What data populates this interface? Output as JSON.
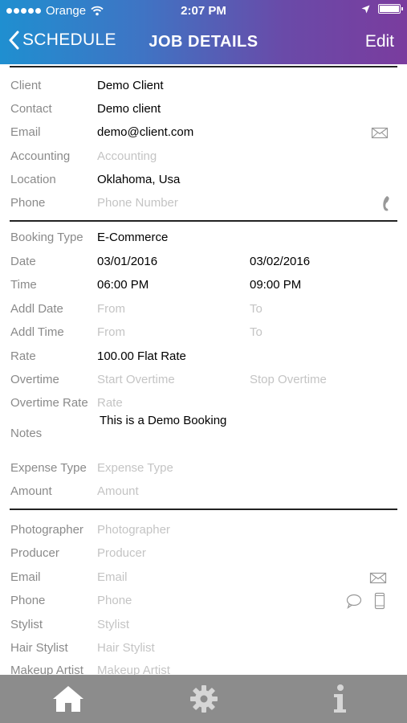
{
  "status_bar": {
    "carrier": "Orange",
    "time": "2:07 PM"
  },
  "nav": {
    "back_label": "SCHEDULE",
    "title": "JOB DETAILS",
    "edit_label": "Edit"
  },
  "client_section": {
    "client": {
      "label": "Client",
      "value": "Demo Client"
    },
    "contact": {
      "label": "Contact",
      "value": "Demo client"
    },
    "email": {
      "label": "Email",
      "value": "demo@client.com"
    },
    "accounting": {
      "label": "Accounting",
      "placeholder": "Accounting"
    },
    "location": {
      "label": "Location",
      "value": "Oklahoma, Usa"
    },
    "phone": {
      "label": "Phone",
      "placeholder": "Phone Number"
    }
  },
  "booking_section": {
    "booking_type": {
      "label": "Booking Type",
      "value": "E-Commerce"
    },
    "date": {
      "label": "Date",
      "start": "03/01/2016",
      "end": "03/02/2016"
    },
    "time": {
      "label": "Time",
      "start": "06:00 PM",
      "end": "09:00 PM"
    },
    "addl_date": {
      "label": "Addl Date",
      "start_placeholder": "From",
      "end_placeholder": "To"
    },
    "addl_time": {
      "label": "Addl Time",
      "start_placeholder": "From",
      "end_placeholder": "To"
    },
    "rate": {
      "label": "Rate",
      "value": "100.00 Flat Rate"
    },
    "overtime": {
      "label": "Overtime",
      "start_placeholder": "Start Overtime",
      "end_placeholder": "Stop Overtime"
    },
    "overtime_rate": {
      "label": "Overtime Rate",
      "placeholder": "Rate"
    },
    "notes": {
      "label": "Notes",
      "value": "This is a Demo Booking"
    },
    "expense_type": {
      "label": "Expense Type",
      "placeholder": "Expense Type"
    },
    "amount": {
      "label": "Amount",
      "placeholder": "Amount"
    }
  },
  "crew_section": {
    "photographer": {
      "label": "Photographer",
      "placeholder": "Photographer"
    },
    "producer": {
      "label": "Producer",
      "placeholder": "Producer"
    },
    "email": {
      "label": "Email",
      "placeholder": "Email"
    },
    "phone": {
      "label": "Phone",
      "placeholder": "Phone"
    },
    "stylist": {
      "label": "Stylist",
      "placeholder": "Stylist"
    },
    "hair_stylist": {
      "label": "Hair Stylist",
      "placeholder": "Hair Stylist"
    },
    "makeup_artist": {
      "label": "Makeup Artist",
      "placeholder": "Makeup Artist"
    }
  },
  "tab_bar": {
    "items": [
      "home-icon",
      "gear-icon",
      "info-icon"
    ]
  },
  "colors": {
    "header_start": "#1f8fd0",
    "header_end": "#7a3c9e",
    "tab_bar": "#8c8c8c",
    "placeholder": "#c4c4c4",
    "label": "#8a8a8a"
  }
}
